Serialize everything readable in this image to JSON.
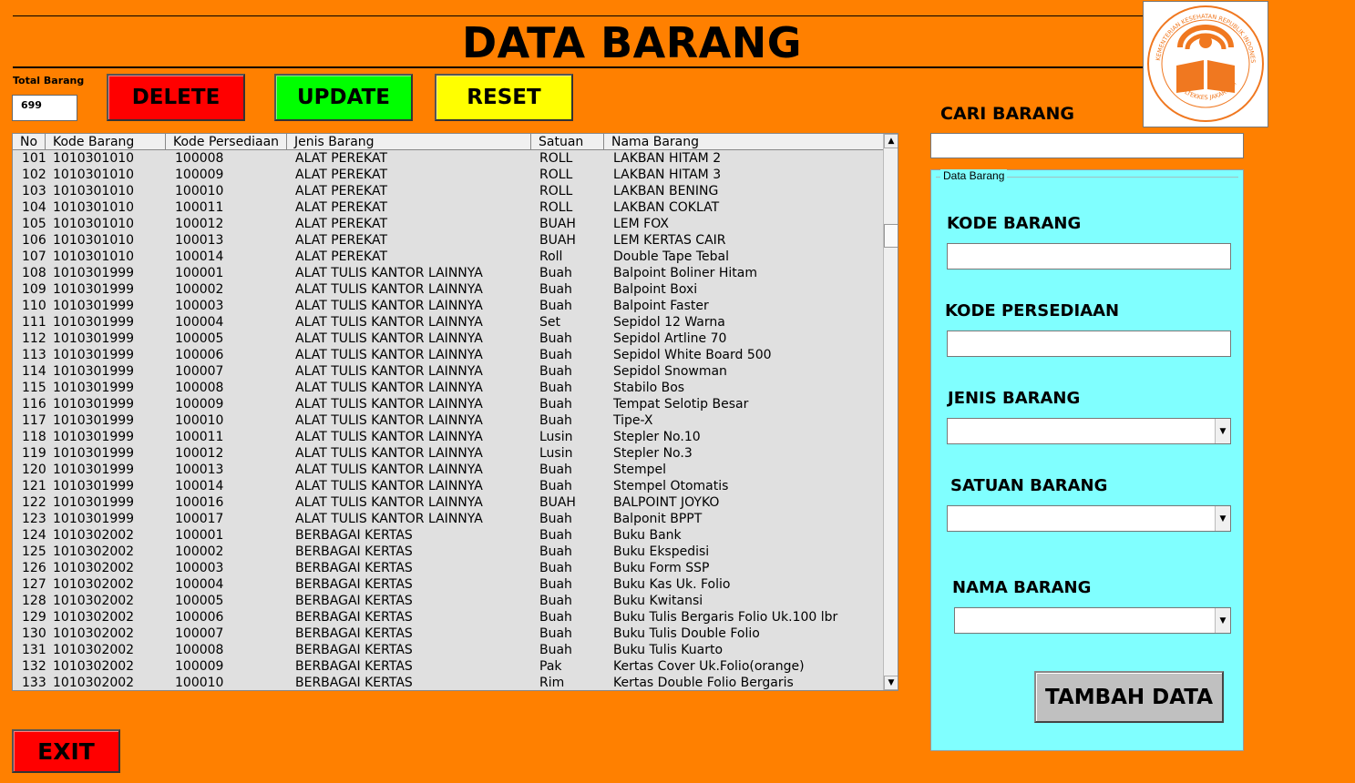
{
  "header": {
    "title": "DATA BARANG"
  },
  "logo": {
    "ring_text_top": "KEMENTERIAN KESEHATAN REPUBLIK INDONESIA",
    "ring_text_bottom": "POLTEKKES JAKARTA III",
    "accent": "#f07820"
  },
  "total": {
    "label": "Total Barang",
    "value": "699"
  },
  "toolbar": {
    "delete_label": "DELETE",
    "update_label": "UPDATE",
    "reset_label": "RESET",
    "exit_label": "EXIT"
  },
  "table": {
    "columns": [
      "No",
      "Kode Barang",
      "Kode Persediaan",
      "Jenis Barang",
      "Satuan",
      "Nama Barang"
    ],
    "rows": [
      [
        "101",
        "1010301010",
        "100008",
        "ALAT PEREKAT",
        "ROLL",
        "LAKBAN HITAM 2"
      ],
      [
        "102",
        "1010301010",
        "100009",
        "ALAT PEREKAT",
        "ROLL",
        "LAKBAN HITAM 3"
      ],
      [
        "103",
        "1010301010",
        "100010",
        "ALAT PEREKAT",
        "ROLL",
        "LAKBAN BENING"
      ],
      [
        "104",
        "1010301010",
        "100011",
        "ALAT PEREKAT",
        "ROLL",
        "LAKBAN COKLAT"
      ],
      [
        "105",
        "1010301010",
        "100012",
        "ALAT PEREKAT",
        "BUAH",
        "LEM FOX"
      ],
      [
        "106",
        "1010301010",
        "100013",
        "ALAT PEREKAT",
        "BUAH",
        "LEM KERTAS CAIR"
      ],
      [
        "107",
        "1010301010",
        "100014",
        "ALAT PEREKAT",
        "Roll",
        "Double Tape Tebal"
      ],
      [
        "108",
        "1010301999",
        "100001",
        "ALAT TULIS KANTOR LAINNYA",
        "Buah",
        "Balpoint Boliner Hitam"
      ],
      [
        "109",
        "1010301999",
        "100002",
        "ALAT TULIS KANTOR LAINNYA",
        "Buah",
        "Balpoint Boxi"
      ],
      [
        "110",
        "1010301999",
        "100003",
        "ALAT TULIS KANTOR LAINNYA",
        "Buah",
        "Balpoint Faster"
      ],
      [
        "111",
        "1010301999",
        "100004",
        "ALAT TULIS KANTOR LAINNYA",
        "Set",
        "Sepidol 12 Warna"
      ],
      [
        "112",
        "1010301999",
        "100005",
        "ALAT TULIS KANTOR LAINNYA",
        "Buah",
        "Sepidol Artline 70"
      ],
      [
        "113",
        "1010301999",
        "100006",
        "ALAT TULIS KANTOR LAINNYA",
        "Buah",
        "Sepidol White Board 500"
      ],
      [
        "114",
        "1010301999",
        "100007",
        "ALAT TULIS KANTOR LAINNYA",
        "Buah",
        "Sepidol Snowman"
      ],
      [
        "115",
        "1010301999",
        "100008",
        "ALAT TULIS KANTOR LAINNYA",
        "Buah",
        "Stabilo Bos"
      ],
      [
        "116",
        "1010301999",
        "100009",
        "ALAT TULIS KANTOR LAINNYA",
        "Buah",
        "Tempat Selotip Besar"
      ],
      [
        "117",
        "1010301999",
        "100010",
        "ALAT TULIS KANTOR LAINNYA",
        "Buah",
        "Tipe-X"
      ],
      [
        "118",
        "1010301999",
        "100011",
        "ALAT TULIS KANTOR LAINNYA",
        "Lusin",
        "Stepler No.10"
      ],
      [
        "119",
        "1010301999",
        "100012",
        "ALAT TULIS KANTOR LAINNYA",
        "Lusin",
        "Stepler No.3"
      ],
      [
        "120",
        "1010301999",
        "100013",
        "ALAT TULIS KANTOR LAINNYA",
        "Buah",
        "Stempel"
      ],
      [
        "121",
        "1010301999",
        "100014",
        "ALAT TULIS KANTOR LAINNYA",
        "Buah",
        "Stempel Otomatis"
      ],
      [
        "122",
        "1010301999",
        "100016",
        "ALAT TULIS KANTOR LAINNYA",
        "BUAH",
        "BALPOINT JOYKO"
      ],
      [
        "123",
        "1010301999",
        "100017",
        "ALAT TULIS KANTOR LAINNYA",
        "Buah",
        "Balponit BPPT"
      ],
      [
        "124",
        "1010302002",
        "100001",
        "BERBAGAI KERTAS",
        "Buah",
        "Buku Bank"
      ],
      [
        "125",
        "1010302002",
        "100002",
        "BERBAGAI KERTAS",
        "Buah",
        "Buku Ekspedisi"
      ],
      [
        "126",
        "1010302002",
        "100003",
        "BERBAGAI KERTAS",
        "Buah",
        "Buku Form SSP"
      ],
      [
        "127",
        "1010302002",
        "100004",
        "BERBAGAI KERTAS",
        "Buah",
        "Buku Kas Uk. Folio"
      ],
      [
        "128",
        "1010302002",
        "100005",
        "BERBAGAI KERTAS",
        "Buah",
        "Buku Kwitansi"
      ],
      [
        "129",
        "1010302002",
        "100006",
        "BERBAGAI KERTAS",
        "Buah",
        "Buku Tulis Bergaris Folio Uk.100 lbr"
      ],
      [
        "130",
        "1010302002",
        "100007",
        "BERBAGAI KERTAS",
        "Buah",
        "Buku Tulis Double Folio"
      ],
      [
        "131",
        "1010302002",
        "100008",
        "BERBAGAI KERTAS",
        "Buah",
        "Buku Tulis Kuarto"
      ],
      [
        "132",
        "1010302002",
        "100009",
        "BERBAGAI KERTAS",
        "Pak",
        "Kertas Cover Uk.Folio(orange)"
      ],
      [
        "133",
        "1010302002",
        "100010",
        "BERBAGAI KERTAS",
        "Rim",
        "Kertas Double Folio Bergaris"
      ]
    ]
  },
  "search": {
    "label": "CARI BARANG",
    "value": ""
  },
  "form": {
    "legend": "Data Barang",
    "kode_barang_label": "KODE BARANG",
    "kode_barang_value": "",
    "kode_persediaan_label": "KODE PERSEDIAAN",
    "kode_persediaan_value": "",
    "jenis_barang_label": "JENIS BARANG",
    "jenis_barang_value": "",
    "satuan_barang_label": "SATUAN BARANG",
    "satuan_barang_value": "",
    "nama_barang_label": "NAMA BARANG",
    "nama_barang_value": "",
    "submit_label": "TAMBAH DATA"
  },
  "colors": {
    "background": "#ff8000",
    "delete": "#ff0000",
    "update": "#00ff00",
    "reset": "#ffff00",
    "panel": "#80ffff",
    "tambah": "#c0c0c0"
  }
}
